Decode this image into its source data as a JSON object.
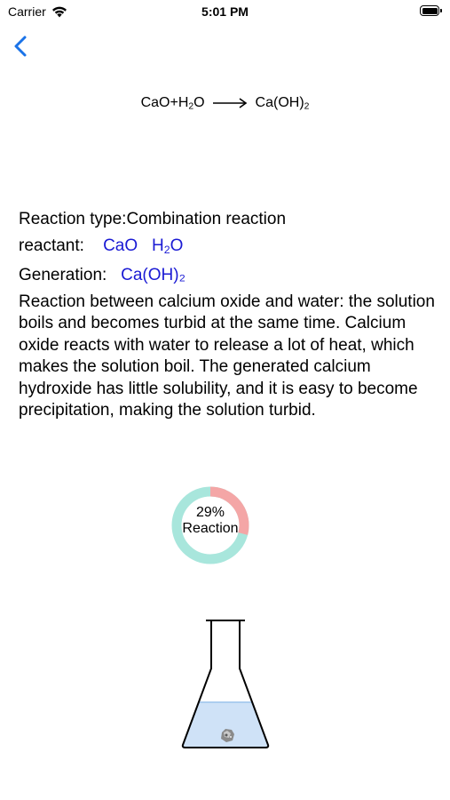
{
  "status_bar": {
    "carrier": "Carrier",
    "time": "5:01 PM",
    "wifi_icon": "wifi-icon",
    "battery_icon": "battery-icon"
  },
  "nav": {
    "back_icon": "chevron-left-icon",
    "accent_color": "#1a73e8"
  },
  "equation": {
    "reactant1": "CaO",
    "plus": "+",
    "reactant2_base": "H",
    "reactant2_sub": "2",
    "reactant2_tail": "O",
    "product_base": "Ca(OH)",
    "product_sub": "2"
  },
  "info": {
    "reaction_type_label": "Reaction type:",
    "reaction_type_value": "Combination reaction",
    "reactant_label": "reactant:",
    "reactant_1": "CaO",
    "reactant_2_base": "H",
    "reactant_2_sub": "2",
    "reactant_2_tail": "O",
    "generation_label": "Generation:",
    "generation_value": "Ca(OH)₂",
    "description": "Reaction between calcium oxide and water: the solution boils and becomes turbid at the same time. Calcium oxide reacts with water to release a lot of heat, which makes the solution boil. The generated calcium hydroxide has little solubility, and it is easy to become precipitation, making the solution turbid.",
    "link_color": "#1a1ad4"
  },
  "progress": {
    "percent_text": "29%",
    "label": "Reaction",
    "value": 0.29,
    "done_color": "#f4a6a6",
    "remaining_color": "#a8e6dc"
  },
  "flask": {
    "icon": "erlenmeyer-flask-icon",
    "liquid_color": "#cfe2f7"
  }
}
